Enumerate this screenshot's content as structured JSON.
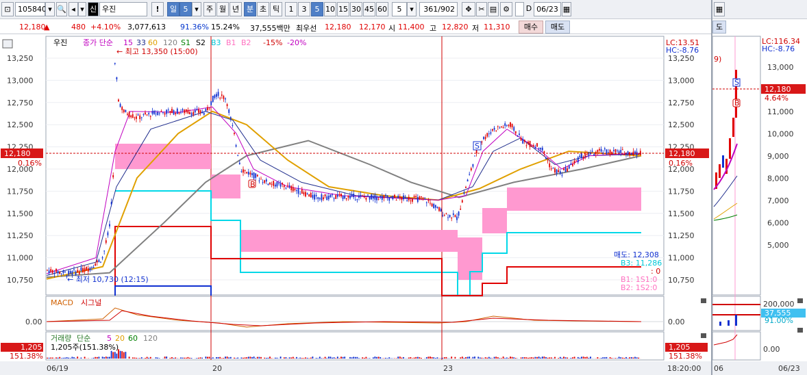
{
  "toolbar": {
    "code": "105840",
    "credit_badge": "신",
    "stock_name": "우진",
    "alert": "!",
    "period_day": "일",
    "period_day_num": "5",
    "period_week": "주",
    "period_month": "월",
    "period_year": "년",
    "period_min": "분",
    "period_sec": "초",
    "period_tick": "틱",
    "intervals": [
      "1",
      "3",
      "5",
      "10",
      "15",
      "30",
      "45",
      "60"
    ],
    "selected_interval": "5",
    "count": "5",
    "range": "361/902",
    "date_value": "06/23",
    "date_checkbox_label": "D"
  },
  "quote": {
    "price": "12,180",
    "change": "480",
    "change_pct": "+4.10%",
    "volume": "3,077,613",
    "vol_ratio": "91.36%",
    "turnover": "15.24%",
    "amount": "37,555백만",
    "best_label": "최우선",
    "best_ask": "12,180",
    "best_bid": "12,170",
    "open_label": "시",
    "open": "11,400",
    "high_label": "고",
    "high": "12,820",
    "low_label": "저",
    "low": "11,310",
    "buy_button": "매수",
    "sell_button": "매도"
  },
  "legend": {
    "stock": "우진",
    "ma_title": "종가 단순",
    "ma_15": "15",
    "ma_33": "33",
    "ma_60": "60",
    "ma_120": "120",
    "s1": "S1",
    "s2": "S2",
    "b3": "B3",
    "b1": "B1",
    "b2": "B2",
    "pct_minus15": "-15%",
    "pct_minus20": "-20%",
    "max_label": "최고 13,350 (15:00)",
    "min_label": "최저 10,730 (12:15)",
    "lc": "LC:13.51",
    "hc": "HC:-8.76"
  },
  "price_axis": {
    "ticks": [
      "13,250",
      "13,000",
      "12,750",
      "12,500",
      "12,250",
      "12,000",
      "11,750",
      "11,500",
      "11,250",
      "11,000",
      "10,750"
    ],
    "current_price": "12,180",
    "current_pct": "0.16%"
  },
  "signal_box": {
    "sell": "매도: 12,308",
    "b3": "B3: 11,286",
    "colon0": ": 0",
    "b1": "B1: 1S1:0",
    "b2": "B2: 1S2:0"
  },
  "macd": {
    "title": "MACD",
    "signal": "시그널",
    "zero": "0.00"
  },
  "volume_pane": {
    "title": "거래량",
    "ma_title": "단순",
    "ma_5": "5",
    "ma_20": "20",
    "ma_60": "60",
    "ma_120": "120",
    "current": "1,205주(151.38%)",
    "left_value": "1,205",
    "left_pct": "151.38%",
    "right_value": "1,205",
    "right_pct": "151.38%"
  },
  "time_axis": {
    "labels": [
      "06/19",
      "20",
      "23"
    ],
    "clock": "18:20:00"
  },
  "side_window": {
    "tab_label": "도",
    "lc": "LC:116.34",
    "hc": "HC:-8.76",
    "price_ticks": [
      "13,000",
      "12,000",
      "11,000",
      "10,000",
      "9,000",
      "8,000",
      "7,000",
      "6,000",
      "5,000"
    ],
    "current_price": "12,180",
    "current_pct": "4.64%",
    "volume_ticks": [
      "200,000"
    ],
    "volume_current": "37,555",
    "volume_pct": "91.00%",
    "macd_zero": "0.00",
    "date_left": "06",
    "date_right": "06/23",
    "callout": "9)"
  },
  "colors": {
    "up": "#e00000",
    "down": "#0033cc",
    "ma15": "#c000c0",
    "ma33": "#1e2c8c",
    "ma60": "#e0a000",
    "ma120": "#808080",
    "band": "#ff8fcf",
    "cyan": "#00d8e8"
  }
}
